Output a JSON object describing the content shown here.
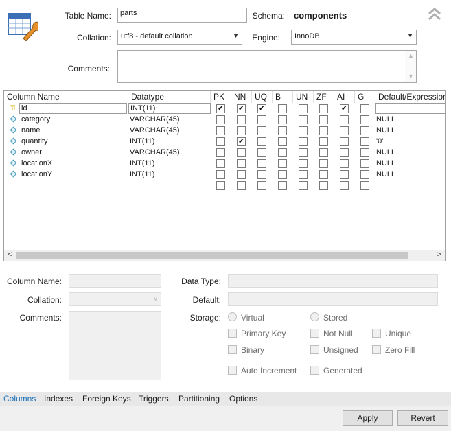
{
  "table_name": {
    "label": "Table Name:",
    "value": "parts"
  },
  "schema": {
    "label": "Schema:",
    "value": "components"
  },
  "collation": {
    "label": "Collation:",
    "value": "utf8 - default collation"
  },
  "engine": {
    "label": "Engine:",
    "value": "InnoDB"
  },
  "comments": {
    "label": "Comments:",
    "value": ""
  },
  "grid": {
    "headers": {
      "column_name": "Column Name",
      "datatype": "Datatype",
      "pk": "PK",
      "nn": "NN",
      "uq": "UQ",
      "b": "B",
      "un": "UN",
      "zf": "ZF",
      "ai": "AI",
      "g": "G",
      "default": "Default/Expression"
    },
    "rows": [
      {
        "name": "id",
        "datatype": "INT(11)",
        "pk": true,
        "nn": true,
        "uq": true,
        "b": false,
        "un": false,
        "zf": false,
        "ai": true,
        "g": false,
        "default": "",
        "primary": true
      },
      {
        "name": "category",
        "datatype": "VARCHAR(45)",
        "pk": false,
        "nn": false,
        "uq": false,
        "b": false,
        "un": false,
        "zf": false,
        "ai": false,
        "g": false,
        "default": "NULL"
      },
      {
        "name": "name",
        "datatype": "VARCHAR(45)",
        "pk": false,
        "nn": false,
        "uq": false,
        "b": false,
        "un": false,
        "zf": false,
        "ai": false,
        "g": false,
        "default": "NULL"
      },
      {
        "name": "quantity",
        "datatype": "INT(11)",
        "pk": false,
        "nn": true,
        "uq": false,
        "b": false,
        "un": false,
        "zf": false,
        "ai": false,
        "g": false,
        "default": "'0'"
      },
      {
        "name": "owner",
        "datatype": "VARCHAR(45)",
        "pk": false,
        "nn": false,
        "uq": false,
        "b": false,
        "un": false,
        "zf": false,
        "ai": false,
        "g": false,
        "default": "NULL"
      },
      {
        "name": "locationX",
        "datatype": "INT(11)",
        "pk": false,
        "nn": false,
        "uq": false,
        "b": false,
        "un": false,
        "zf": false,
        "ai": false,
        "g": false,
        "default": "NULL"
      },
      {
        "name": "locationY",
        "datatype": "INT(11)",
        "pk": false,
        "nn": false,
        "uq": false,
        "b": false,
        "un": false,
        "zf": false,
        "ai": false,
        "g": false,
        "default": "NULL"
      }
    ],
    "scroll_left": "<",
    "scroll_right": ">"
  },
  "detail": {
    "column_name_label": "Column Name:",
    "collation_label": "Collation:",
    "comments_label": "Comments:",
    "data_type_label": "Data Type:",
    "default_label": "Default:",
    "storage_label": "Storage:",
    "virtual": "Virtual",
    "stored": "Stored",
    "primary_key": "Primary Key",
    "not_null": "Not Null",
    "unique": "Unique",
    "binary": "Binary",
    "unsigned": "Unsigned",
    "zero_fill": "Zero Fill",
    "auto_increment": "Auto Increment",
    "generated": "Generated"
  },
  "tabs": [
    "Columns",
    "Indexes",
    "Foreign Keys",
    "Triggers",
    "Partitioning",
    "Options"
  ],
  "active_tab": "Columns",
  "buttons": {
    "apply": "Apply",
    "revert": "Revert"
  },
  "icons": {
    "table_icon": "table-wrench-icon",
    "collapse_icon": "double-chevron-up-icon",
    "key_icon": "key-icon",
    "column_icon": "diamond-icon"
  },
  "colors": {
    "active_tab": "#1a6fb5",
    "tabbar_bg": "#e8e8e8"
  }
}
